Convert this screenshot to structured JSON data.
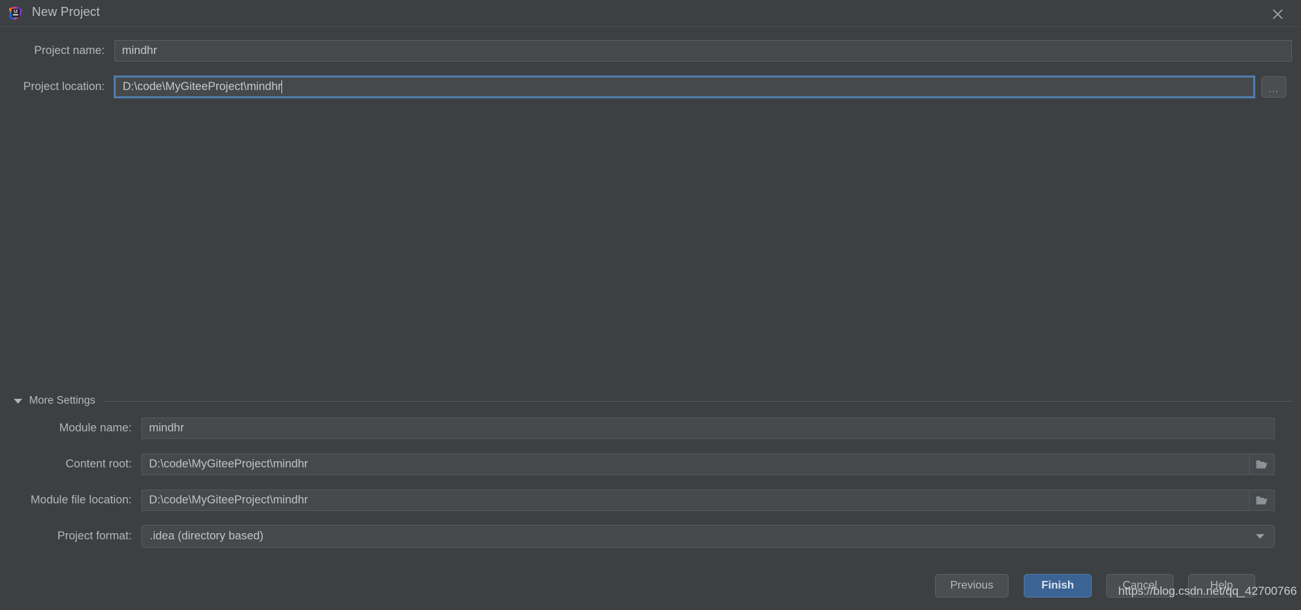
{
  "window": {
    "title": "New Project",
    "app_icon": "intellij-idea-logo",
    "close_icon": "close-icon"
  },
  "form": {
    "project_name": {
      "label": "Project name:",
      "value": "mindhr"
    },
    "project_location": {
      "label": "Project location:",
      "value": "D:\\code\\MyGiteeProject\\mindhr",
      "focused": true,
      "browse_label": "..."
    }
  },
  "more_settings": {
    "label": "More Settings",
    "expanded": true,
    "toggle_icon": "chevron-down-icon",
    "fields": [
      {
        "label": "Module name:",
        "value": "mindhr",
        "control": "text",
        "trailing_icon": null
      },
      {
        "label": "Content root:",
        "value": "D:\\code\\MyGiteeProject\\mindhr",
        "control": "text",
        "trailing_icon": "folder-icon"
      },
      {
        "label": "Module file location:",
        "value": "D:\\code\\MyGiteeProject\\mindhr",
        "control": "text",
        "trailing_icon": "folder-icon"
      },
      {
        "label": "Project format:",
        "value": ".idea (directory based)",
        "control": "dropdown",
        "trailing_icon": "chevron-down-icon"
      }
    ]
  },
  "buttons": {
    "previous": "Previous",
    "finish": "Finish",
    "cancel": "Cancel",
    "help": "Help"
  },
  "watermark": {
    "text": "https://blog.csdn.net/qq_42700766"
  },
  "colors": {
    "background": "#3c4043",
    "field_bg": "#45494c",
    "field_border": "#55595c",
    "focus_blue": "#4f7cac",
    "primary_button": "#3b6394",
    "text": "#bbbbbb"
  }
}
